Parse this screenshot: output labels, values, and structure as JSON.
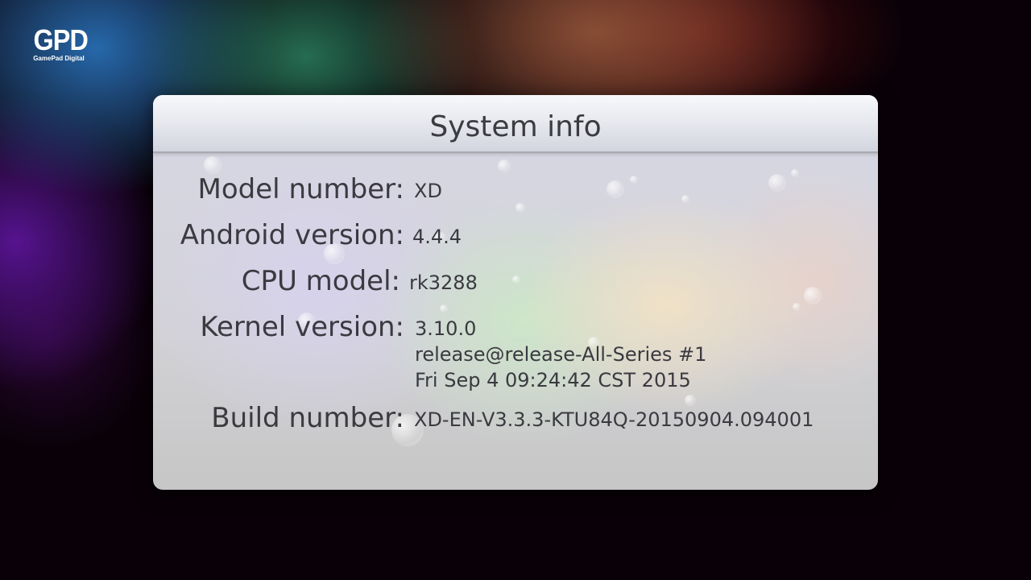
{
  "brand": {
    "logo_text": "GPD",
    "logo_subtitle": "GamePad Digital"
  },
  "dialog": {
    "title": "System info",
    "rows": [
      {
        "label": "Model number:",
        "value": "XD"
      },
      {
        "label": "Android version:",
        "value": "4.4.4"
      },
      {
        "label": "CPU model:",
        "value": "rk3288"
      },
      {
        "label": "Kernel version:",
        "value_lines": [
          "3.10.0",
          "release@release-All-Series #1",
          "Fri Sep 4 09:24:42 CST 2015"
        ]
      },
      {
        "label": "Build number:",
        "value": "XD-EN-V3.3.3-KTU84Q-20150904.094001"
      }
    ]
  }
}
